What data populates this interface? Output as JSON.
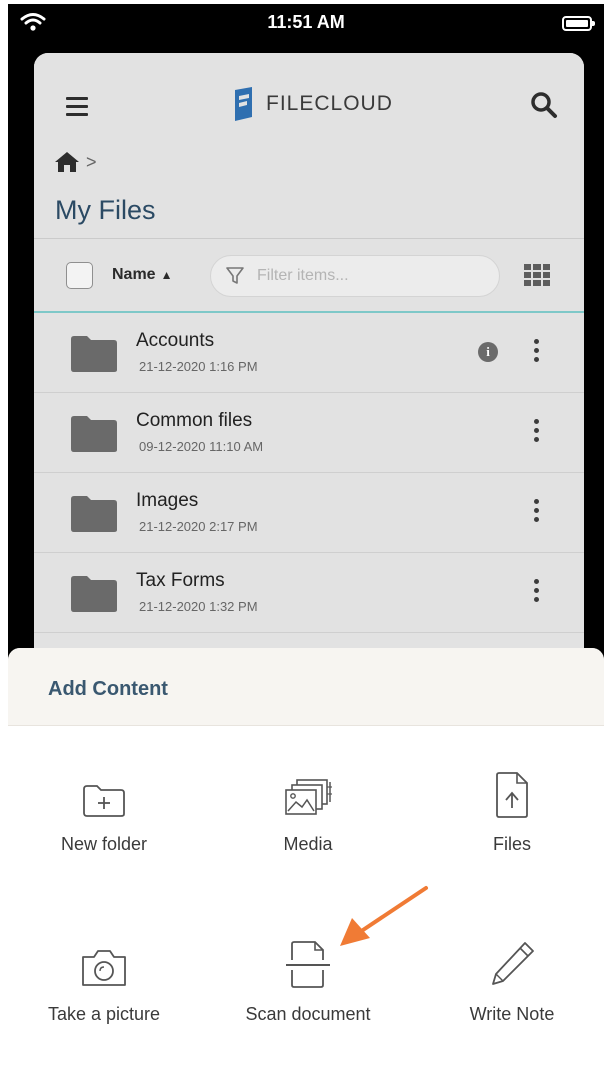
{
  "status_bar": {
    "time": "11:51 AM"
  },
  "app": {
    "logo_text": "FILECLOUD",
    "breadcrumb_separator": ">",
    "page_title": "My Files",
    "toolbar": {
      "sort_label": "Name",
      "sort_arrow": "▲",
      "filter_placeholder": "Filter items..."
    },
    "files": [
      {
        "name": "Accounts",
        "date": "21-12-2020 1:16 PM",
        "has_info": true
      },
      {
        "name": "Common files",
        "date": "09-12-2020 11:10 AM",
        "has_info": false
      },
      {
        "name": "Images",
        "date": "21-12-2020 2:17 PM",
        "has_info": false
      },
      {
        "name": "Tax Forms",
        "date": "21-12-2020 1:32 PM",
        "has_info": false
      }
    ]
  },
  "sheet": {
    "title": "Add Content",
    "actions": [
      {
        "label": "New folder",
        "icon": "folder-plus-icon"
      },
      {
        "label": "Media",
        "icon": "media-icon"
      },
      {
        "label": "Files",
        "icon": "file-upload-icon"
      },
      {
        "label": "Take a picture",
        "icon": "camera-icon"
      },
      {
        "label": "Scan document",
        "icon": "scan-icon"
      },
      {
        "label": "Write Note",
        "icon": "pencil-icon"
      }
    ]
  },
  "colors": {
    "accent": "#2b4a64",
    "arrow": "#f07b35",
    "divider": "#7ec8c8"
  }
}
